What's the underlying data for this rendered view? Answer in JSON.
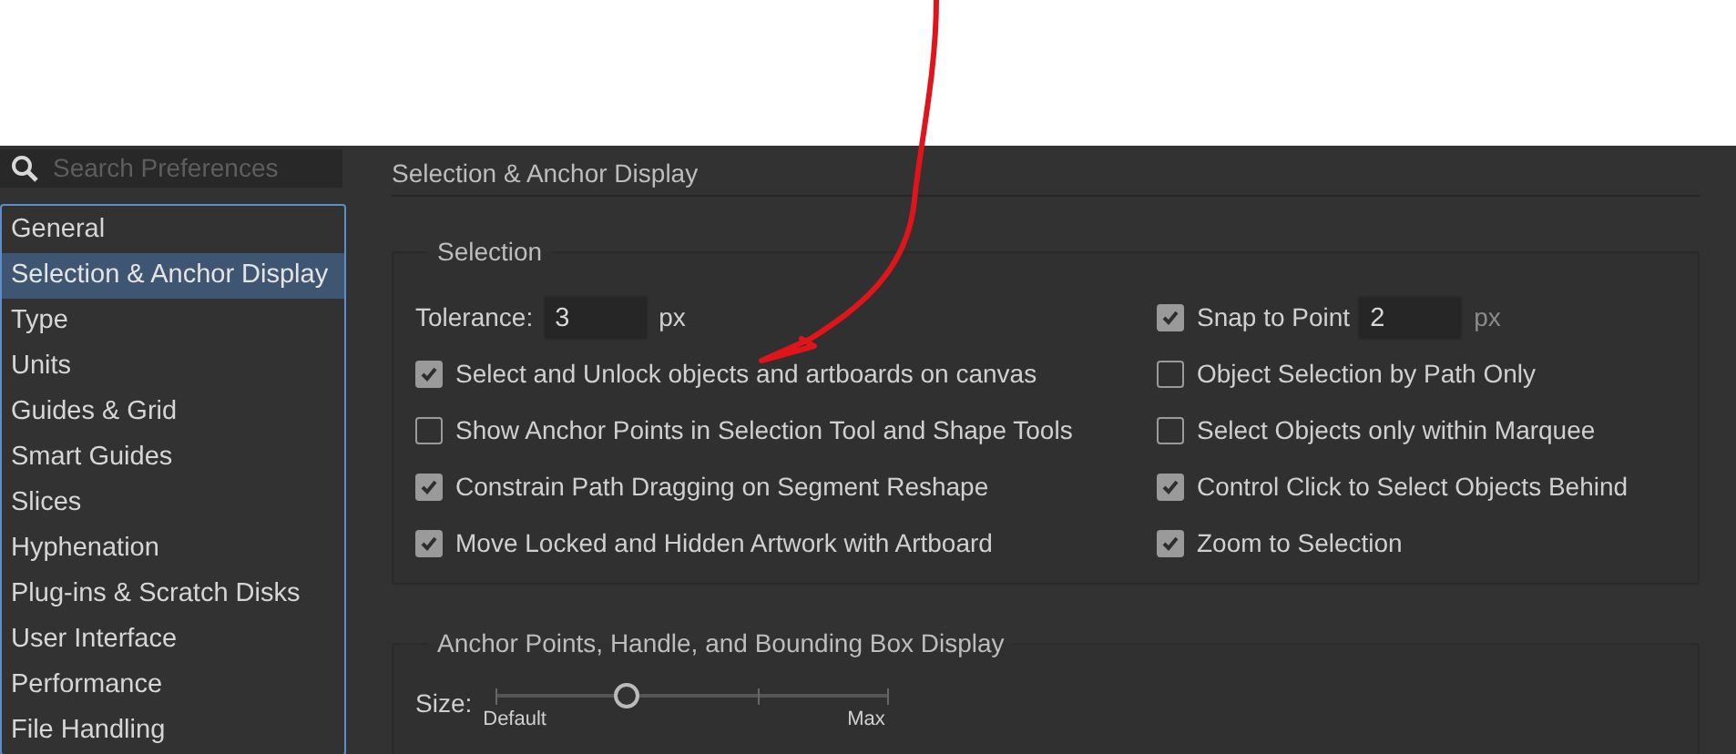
{
  "sidebar": {
    "search": {
      "placeholder": "Search Preferences"
    },
    "items": [
      {
        "label": "General",
        "selected": false
      },
      {
        "label": "Selection & Anchor Display",
        "selected": true
      },
      {
        "label": "Type",
        "selected": false
      },
      {
        "label": "Units",
        "selected": false
      },
      {
        "label": "Guides & Grid",
        "selected": false
      },
      {
        "label": "Smart Guides",
        "selected": false
      },
      {
        "label": "Slices",
        "selected": false
      },
      {
        "label": "Hyphenation",
        "selected": false
      },
      {
        "label": "Plug-ins & Scratch Disks",
        "selected": false
      },
      {
        "label": "User Interface",
        "selected": false
      },
      {
        "label": "Performance",
        "selected": false
      },
      {
        "label": "File Handling",
        "selected": false
      }
    ]
  },
  "panel": {
    "title": "Selection & Anchor Display",
    "selection": {
      "title": "Selection",
      "tolerance": {
        "label": "Tolerance:",
        "value": "3",
        "unit": "px"
      },
      "snap": {
        "label": "Snap to Point",
        "checked": true,
        "value": "2",
        "unit": "px"
      },
      "left_options": [
        {
          "label": "Select and Unlock objects and artboards on canvas",
          "checked": true
        },
        {
          "label": "Show Anchor Points in Selection Tool and Shape Tools",
          "checked": false
        },
        {
          "label": "Constrain Path Dragging on Segment Reshape",
          "checked": true
        },
        {
          "label": "Move Locked and Hidden Artwork with Artboard",
          "checked": true
        }
      ],
      "right_options": [
        {
          "label": "Object Selection by Path Only",
          "checked": false
        },
        {
          "label": "Select Objects only within Marquee",
          "checked": false
        },
        {
          "label": "Control Click to Select Objects Behind",
          "checked": true
        },
        {
          "label": "Zoom to Selection",
          "checked": true
        }
      ]
    },
    "display": {
      "title": "Anchor Points, Handle, and Bounding Box Display",
      "size": {
        "label": "Size:",
        "level": 0.333,
        "min_label": "Default",
        "max_label": "Max"
      }
    }
  }
}
